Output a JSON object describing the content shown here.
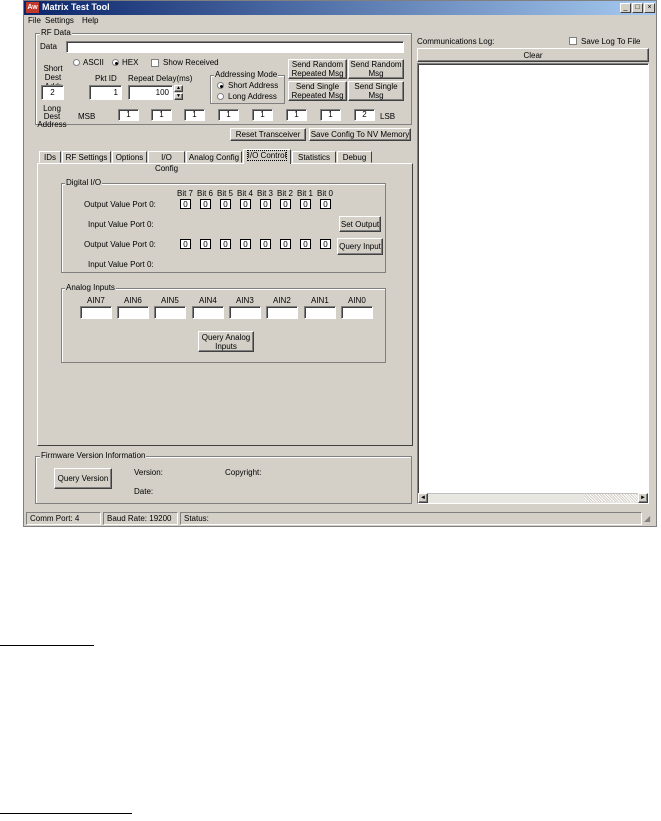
{
  "window": {
    "title": "Matrix Test Tool",
    "icon": "app-logo-icon"
  },
  "menu": [
    "File",
    "Settings",
    "Help"
  ],
  "rf_data": {
    "group_label": "RF Data",
    "data_label": "Data",
    "data_value": "",
    "ascii_label": "ASCII",
    "hex_label": "HEX",
    "show_received_label": "Show Received",
    "short_dest_addr_label": "Short Dest Addr",
    "short_dest_addr_value": "2",
    "pkt_id_label": "Pkt ID",
    "pkt_id_value": "1",
    "repeat_delay_label": "Repeat Delay(ms)",
    "repeat_delay_value": "100",
    "addressing_mode_label": "Addressing Mode",
    "short_address_label": "Short Address",
    "long_address_label": "Long Address",
    "send_random_repeated": "Send Random Repeated Msg",
    "send_random": "Send Random Msg",
    "send_single_repeated": "Send Single Repeated Msg",
    "send_single": "Send Single Msg",
    "long_dest_label": "Long Dest Address",
    "msb_label": "MSB",
    "lsb_label": "LSB",
    "long_dest_values": [
      "1",
      "1",
      "1",
      "1",
      "1",
      "1",
      "1",
      "2"
    ]
  },
  "buttons": {
    "reset_transceiver": "Reset Transceiver",
    "save_config": "Save Config To NV Memory"
  },
  "tabs": [
    "IDs",
    "RF Settings",
    "Options",
    "I/O Config",
    "Analog Config",
    "I/O Control",
    "Statistics",
    "Debug"
  ],
  "digital_io": {
    "group_label": "Digital I/O",
    "bits": [
      "Bit 7",
      "Bit 6",
      "Bit 5",
      "Bit 4",
      "Bit 3",
      "Bit 2",
      "Bit 1",
      "Bit 0"
    ],
    "output_label_1": "Output Value Port 0:",
    "input_label_1": "Input Value Port 0:",
    "output_label_2": "Output Value Port 0:",
    "input_label_2": "Input Value Port 0:",
    "row1_values": [
      "0",
      "0",
      "0",
      "0",
      "0",
      "0",
      "0",
      "0"
    ],
    "row2_values": [
      "0",
      "0",
      "0",
      "0",
      "0",
      "0",
      "0",
      "0"
    ],
    "set_output": "Set Output",
    "query_input": "Query Input"
  },
  "analog_inputs": {
    "group_label": "Analog Inputs",
    "channels": [
      "AIN7",
      "AIN6",
      "AIN5",
      "AIN4",
      "AIN3",
      "AIN2",
      "AIN1",
      "AIN0"
    ],
    "query_button": "Query Analog Inputs"
  },
  "firmware": {
    "group_label": "Firmware Version Information",
    "query_button": "Query Version",
    "version_label": "Version:",
    "copyright_label": "Copyright:",
    "date_label": "Date:"
  },
  "comm_log": {
    "label": "Communications Log:",
    "save_log_label": "Save Log To File",
    "clear_button": "Clear"
  },
  "status": {
    "comm_port": "Comm Port: 4",
    "baud_rate": "Baud Rate: 19200",
    "status": "Status:"
  }
}
